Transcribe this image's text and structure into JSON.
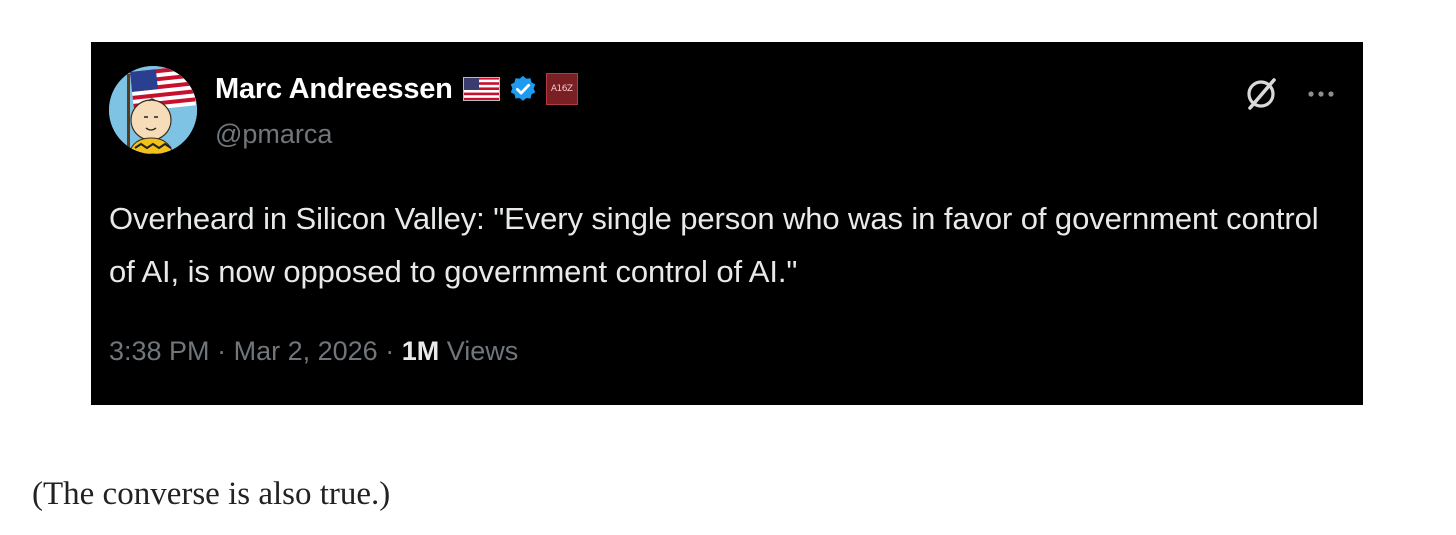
{
  "tweet": {
    "author": {
      "display_name": "Marc Andreessen",
      "handle": "@pmarca",
      "avatar_icon": "cartoon-boy-with-flag-icon",
      "badges": [
        "us-flag-icon",
        "verified-icon",
        "affiliate-badge"
      ],
      "affiliate_badge_text": "A16Z"
    },
    "text": "Overheard in Silicon Valley: \"Every single person who was in favor of government control of AI, is now opposed to government control of AI.\"",
    "time": "3:38 PM",
    "date": "Mar 2, 2026",
    "views_count": "1M",
    "views_label": "Views",
    "actions": [
      "grok-icon",
      "more-icon"
    ],
    "colors": {
      "card_background": "#000000",
      "primary_text": "#e7e9ea",
      "secondary_text": "#71767b",
      "verified_blue": "#1d9bf0"
    }
  },
  "caption": "(The converse is also true.)"
}
